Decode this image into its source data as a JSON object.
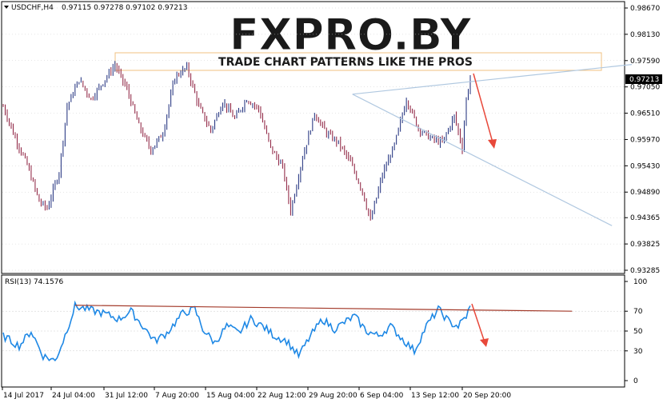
{
  "header": {
    "symbol": "USDCHF,H4",
    "ohlc": "0.97115 0.97278 0.97102 0.97213",
    "rsi_label": "RSI(13) 74.1576"
  },
  "watermark": {
    "logo": "FXPRO.BY",
    "tagline": "TRADE CHART PATTERNS LIKE THE PROS"
  },
  "colors": {
    "bull": "#1a2a7a",
    "bear": "#8a1a3a",
    "rsi_line": "#1e88e5",
    "trendline": "#b0c8e0",
    "rsi_trendline": "#a33a2a",
    "arrow": "#e8483a",
    "price_tag_bg": "#000000",
    "grid": "#cccccc"
  },
  "price_tag": "0.97213",
  "chart_data": [
    {
      "type": "candlestick",
      "title": "USDCHF,H4",
      "x_tick_labels": [
        "14 Jul 2017",
        "24 Jul 04:00",
        "31 Jul 12:00",
        "7 Aug 20:00",
        "15 Aug 04:00",
        "22 Aug 12:00",
        "29 Aug 20:00",
        "6 Sep 04:00",
        "13 Sep 12:00",
        "20 Sep 20:00"
      ],
      "y_tick_labels": [
        "0.98670",
        "0.98130",
        "0.97590",
        "0.97050",
        "0.96510",
        "0.95970",
        "0.95430",
        "0.94890",
        "0.94365",
        "0.93825",
        "0.93285"
      ],
      "ylim": [
        0.93285,
        0.9867
      ],
      "anchor_closes": [
        [
          0,
          0.9665
        ],
        [
          6,
          0.96
        ],
        [
          12,
          0.9545
        ],
        [
          18,
          0.947
        ],
        [
          22,
          0.9455
        ],
        [
          28,
          0.953
        ],
        [
          32,
          0.9665
        ],
        [
          38,
          0.972
        ],
        [
          44,
          0.968
        ],
        [
          50,
          0.9715
        ],
        [
          56,
          0.975
        ],
        [
          62,
          0.97
        ],
        [
          68,
          0.9625
        ],
        [
          74,
          0.9575
        ],
        [
          80,
          0.961
        ],
        [
          86,
          0.9725
        ],
        [
          92,
          0.9745
        ],
        [
          98,
          0.9665
        ],
        [
          104,
          0.9615
        ],
        [
          110,
          0.9675
        ],
        [
          116,
          0.964
        ],
        [
          122,
          0.968
        ],
        [
          128,
          0.966
        ],
        [
          134,
          0.958
        ],
        [
          140,
          0.954
        ],
        [
          144,
          0.945
        ],
        [
          150,
          0.956
        ],
        [
          156,
          0.965
        ],
        [
          162,
          0.961
        ],
        [
          168,
          0.959
        ],
        [
          174,
          0.955
        ],
        [
          180,
          0.949
        ],
        [
          184,
          0.943
        ],
        [
          190,
          0.9525
        ],
        [
          196,
          0.9585
        ],
        [
          202,
          0.968
        ],
        [
          208,
          0.962
        ],
        [
          214,
          0.96
        ],
        [
          220,
          0.959
        ],
        [
          226,
          0.9645
        ],
        [
          230,
          0.958
        ],
        [
          232,
          0.968
        ],
        [
          234,
          0.9721
        ]
      ],
      "resistance_line": {
        "start": [
          175,
          0.969
        ],
        "end": [
          315,
          0.9751
        ]
      },
      "support_line": {
        "start": [
          175,
          0.969
        ],
        "end": [
          305,
          0.942
        ]
      }
    },
    {
      "type": "line",
      "title": "RSI(13) 74.1576",
      "y_tick_labels": [
        "100",
        "70",
        "50",
        "30",
        "0"
      ],
      "ylim": [
        0,
        100
      ],
      "anchor_values": [
        [
          0,
          45
        ],
        [
          8,
          35
        ],
        [
          14,
          50
        ],
        [
          20,
          25
        ],
        [
          26,
          20
        ],
        [
          30,
          40
        ],
        [
          36,
          75
        ],
        [
          42,
          72
        ],
        [
          50,
          68
        ],
        [
          58,
          62
        ],
        [
          64,
          70
        ],
        [
          70,
          55
        ],
        [
          76,
          40
        ],
        [
          82,
          48
        ],
        [
          90,
          68
        ],
        [
          96,
          72
        ],
        [
          100,
          52
        ],
        [
          106,
          38
        ],
        [
          112,
          55
        ],
        [
          118,
          48
        ],
        [
          124,
          62
        ],
        [
          130,
          55
        ],
        [
          136,
          45
        ],
        [
          142,
          40
        ],
        [
          148,
          25
        ],
        [
          154,
          45
        ],
        [
          160,
          62
        ],
        [
          166,
          52
        ],
        [
          172,
          60
        ],
        [
          176,
          65
        ],
        [
          182,
          50
        ],
        [
          188,
          45
        ],
        [
          194,
          55
        ],
        [
          200,
          42
        ],
        [
          206,
          30
        ],
        [
          212,
          55
        ],
        [
          218,
          72
        ],
        [
          224,
          58
        ],
        [
          228,
          55
        ],
        [
          232,
          65
        ],
        [
          234,
          74.16
        ]
      ],
      "trendline": {
        "start": [
          36,
          76
        ],
        "end": [
          285,
          70
        ]
      }
    }
  ]
}
